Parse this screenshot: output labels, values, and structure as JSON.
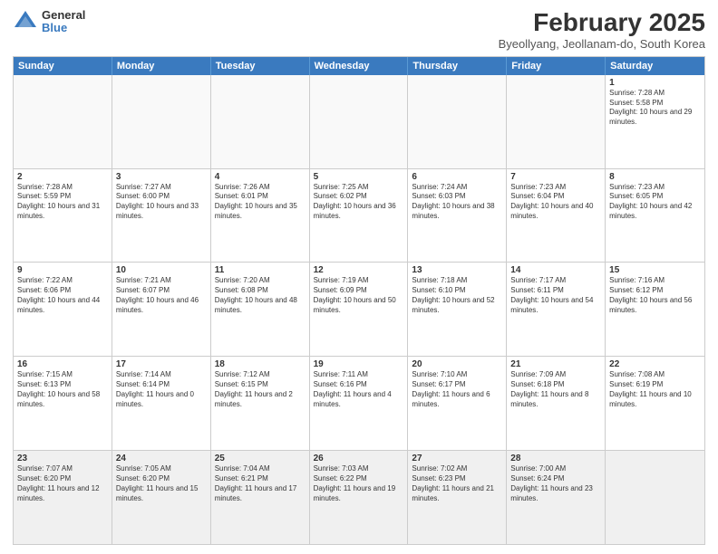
{
  "logo": {
    "general": "General",
    "blue": "Blue"
  },
  "header": {
    "title": "February 2025",
    "subtitle": "Byeollyang, Jeollanam-do, South Korea"
  },
  "days": [
    "Sunday",
    "Monday",
    "Tuesday",
    "Wednesday",
    "Thursday",
    "Friday",
    "Saturday"
  ],
  "rows": [
    [
      {
        "day": "",
        "text": ""
      },
      {
        "day": "",
        "text": ""
      },
      {
        "day": "",
        "text": ""
      },
      {
        "day": "",
        "text": ""
      },
      {
        "day": "",
        "text": ""
      },
      {
        "day": "",
        "text": ""
      },
      {
        "day": "1",
        "text": "Sunrise: 7:28 AM\nSunset: 5:58 PM\nDaylight: 10 hours and 29 minutes."
      }
    ],
    [
      {
        "day": "2",
        "text": "Sunrise: 7:28 AM\nSunset: 5:59 PM\nDaylight: 10 hours and 31 minutes."
      },
      {
        "day": "3",
        "text": "Sunrise: 7:27 AM\nSunset: 6:00 PM\nDaylight: 10 hours and 33 minutes."
      },
      {
        "day": "4",
        "text": "Sunrise: 7:26 AM\nSunset: 6:01 PM\nDaylight: 10 hours and 35 minutes."
      },
      {
        "day": "5",
        "text": "Sunrise: 7:25 AM\nSunset: 6:02 PM\nDaylight: 10 hours and 36 minutes."
      },
      {
        "day": "6",
        "text": "Sunrise: 7:24 AM\nSunset: 6:03 PM\nDaylight: 10 hours and 38 minutes."
      },
      {
        "day": "7",
        "text": "Sunrise: 7:23 AM\nSunset: 6:04 PM\nDaylight: 10 hours and 40 minutes."
      },
      {
        "day": "8",
        "text": "Sunrise: 7:23 AM\nSunset: 6:05 PM\nDaylight: 10 hours and 42 minutes."
      }
    ],
    [
      {
        "day": "9",
        "text": "Sunrise: 7:22 AM\nSunset: 6:06 PM\nDaylight: 10 hours and 44 minutes."
      },
      {
        "day": "10",
        "text": "Sunrise: 7:21 AM\nSunset: 6:07 PM\nDaylight: 10 hours and 46 minutes."
      },
      {
        "day": "11",
        "text": "Sunrise: 7:20 AM\nSunset: 6:08 PM\nDaylight: 10 hours and 48 minutes."
      },
      {
        "day": "12",
        "text": "Sunrise: 7:19 AM\nSunset: 6:09 PM\nDaylight: 10 hours and 50 minutes."
      },
      {
        "day": "13",
        "text": "Sunrise: 7:18 AM\nSunset: 6:10 PM\nDaylight: 10 hours and 52 minutes."
      },
      {
        "day": "14",
        "text": "Sunrise: 7:17 AM\nSunset: 6:11 PM\nDaylight: 10 hours and 54 minutes."
      },
      {
        "day": "15",
        "text": "Sunrise: 7:16 AM\nSunset: 6:12 PM\nDaylight: 10 hours and 56 minutes."
      }
    ],
    [
      {
        "day": "16",
        "text": "Sunrise: 7:15 AM\nSunset: 6:13 PM\nDaylight: 10 hours and 58 minutes."
      },
      {
        "day": "17",
        "text": "Sunrise: 7:14 AM\nSunset: 6:14 PM\nDaylight: 11 hours and 0 minutes."
      },
      {
        "day": "18",
        "text": "Sunrise: 7:12 AM\nSunset: 6:15 PM\nDaylight: 11 hours and 2 minutes."
      },
      {
        "day": "19",
        "text": "Sunrise: 7:11 AM\nSunset: 6:16 PM\nDaylight: 11 hours and 4 minutes."
      },
      {
        "day": "20",
        "text": "Sunrise: 7:10 AM\nSunset: 6:17 PM\nDaylight: 11 hours and 6 minutes."
      },
      {
        "day": "21",
        "text": "Sunrise: 7:09 AM\nSunset: 6:18 PM\nDaylight: 11 hours and 8 minutes."
      },
      {
        "day": "22",
        "text": "Sunrise: 7:08 AM\nSunset: 6:19 PM\nDaylight: 11 hours and 10 minutes."
      }
    ],
    [
      {
        "day": "23",
        "text": "Sunrise: 7:07 AM\nSunset: 6:20 PM\nDaylight: 11 hours and 12 minutes."
      },
      {
        "day": "24",
        "text": "Sunrise: 7:05 AM\nSunset: 6:20 PM\nDaylight: 11 hours and 15 minutes."
      },
      {
        "day": "25",
        "text": "Sunrise: 7:04 AM\nSunset: 6:21 PM\nDaylight: 11 hours and 17 minutes."
      },
      {
        "day": "26",
        "text": "Sunrise: 7:03 AM\nSunset: 6:22 PM\nDaylight: 11 hours and 19 minutes."
      },
      {
        "day": "27",
        "text": "Sunrise: 7:02 AM\nSunset: 6:23 PM\nDaylight: 11 hours and 21 minutes."
      },
      {
        "day": "28",
        "text": "Sunrise: 7:00 AM\nSunset: 6:24 PM\nDaylight: 11 hours and 23 minutes."
      },
      {
        "day": "",
        "text": ""
      }
    ]
  ]
}
